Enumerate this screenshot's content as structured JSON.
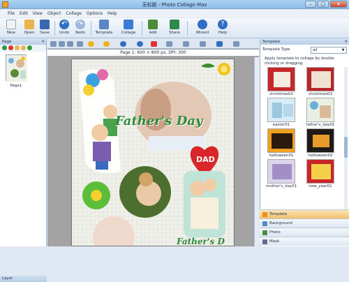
{
  "window": {
    "title": "无标题 - Photo Collage Max",
    "min": "–",
    "max": "□",
    "close": "✕"
  },
  "menu": [
    "File",
    "Edit",
    "View",
    "Object",
    "Collage",
    "Options",
    "Help"
  ],
  "toolbar": [
    {
      "label": "New",
      "icon": "new-icon",
      "color": "#f3f3f3"
    },
    {
      "label": "Open",
      "icon": "open-icon",
      "color": "#e9b44a"
    },
    {
      "label": "Save",
      "icon": "save-icon",
      "color": "#3a68b0"
    },
    {
      "label": "Undo",
      "icon": "undo-icon",
      "color": "#2f6fc4"
    },
    {
      "label": "Redo",
      "icon": "redo-icon",
      "color": "#9db7d6"
    },
    {
      "label": "Template",
      "icon": "template-icon",
      "color": "#5a86c8"
    },
    {
      "label": "Collage",
      "icon": "collage-icon",
      "color": "#3c7bd3"
    },
    {
      "label": "Add",
      "icon": "add-icon",
      "color": "#4a8c3a"
    },
    {
      "label": "Share",
      "icon": "share-icon",
      "color": "#2d8a4a"
    },
    {
      "label": "Wizard",
      "icon": "wizard-icon",
      "color": "#2f6fc4"
    },
    {
      "label": "Help",
      "icon": "help-icon",
      "color": "#2f6fc4"
    }
  ],
  "left_panel": {
    "header": "Page",
    "close": "✕",
    "page_label": "Page1",
    "layer_header": "Layer"
  },
  "canvas": {
    "page_info": "Page 1: 600 × 800 px, DPI: 300",
    "heading": "Father's Day",
    "badge": "DAD",
    "footer_text": "Father's D"
  },
  "right_panel": {
    "header": "Template",
    "close": "✕",
    "template_type_label": "Template Type",
    "template_type_value": "all",
    "hint": "Apply template to collage by double clicking or dragging",
    "templates": [
      "christmas02",
      "christmas03",
      "easter01",
      "father's_day01",
      "halloween01",
      "halloween02",
      "mother's_day01",
      "new_year01"
    ],
    "tabs": [
      "Template",
      "Background",
      "Photo",
      "Mask"
    ]
  },
  "colors": {
    "accent": "#2f6fc4",
    "active_tab": "#f2c06c",
    "title_green": "#2f8a3a",
    "dad_red": "#d8262a"
  }
}
